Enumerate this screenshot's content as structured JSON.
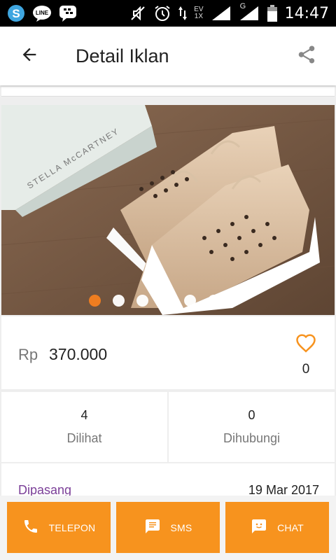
{
  "statusbar": {
    "time": "14:47",
    "network_top": "EV",
    "network_bottom": "1X",
    "signal2_label": "G",
    "icons": [
      "skype-icon",
      "line-icon",
      "bbm-icon",
      "mute-icon",
      "alarm-icon",
      "signal-icon",
      "battery-icon"
    ]
  },
  "appbar": {
    "title": "Detail Iklan",
    "back_icon": "arrow-back-icon",
    "share_icon": "share-icon"
  },
  "gallery": {
    "image_count": 6,
    "active_index": 0,
    "box_text": "STELLA McCARTNEY"
  },
  "price": {
    "currency": "Rp",
    "amount": "370.000",
    "favorites": "0"
  },
  "stats": [
    {
      "value": "4",
      "label": "Dilihat"
    },
    {
      "value": "0",
      "label": "Dihubungi"
    }
  ],
  "posted": {
    "label": "Dipasang",
    "date": "19 Mar 2017"
  },
  "actions": [
    {
      "label": "TELEPON",
      "icon": "phone-icon"
    },
    {
      "label": "SMS",
      "icon": "message-icon"
    },
    {
      "label": "CHAT",
      "icon": "chat-icon"
    }
  ],
  "colors": {
    "accent": "#f7931e",
    "dot_active": "#f57f1f",
    "posted_label": "#7b3f98"
  }
}
